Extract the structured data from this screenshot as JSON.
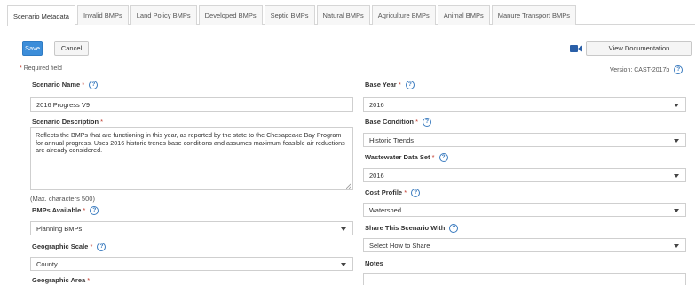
{
  "tabs": [
    {
      "label": "Scenario Metadata",
      "active": true
    },
    {
      "label": "Invalid BMPs"
    },
    {
      "label": "Land Policy BMPs"
    },
    {
      "label": "Developed BMPs"
    },
    {
      "label": "Septic BMPs"
    },
    {
      "label": "Natural BMPs"
    },
    {
      "label": "Agriculture BMPs"
    },
    {
      "label": "Animal BMPs"
    },
    {
      "label": "Manure Transport BMPs"
    }
  ],
  "toolbar": {
    "save_label": "Save",
    "cancel_label": "Cancel",
    "doc_label": "View Documentation"
  },
  "meta": {
    "required_star": "*",
    "required_text": "Required field",
    "version_text": "Version: CAST-2017b",
    "help_glyph": "?"
  },
  "form": {
    "scenario_name": {
      "label": "Scenario Name",
      "value": "2016 Progress V9"
    },
    "scenario_description": {
      "label": "Scenario Description",
      "value": "Reflects the BMPs that are functioning in this year, as reported by the state to the Chesapeake Bay Program for annual progress. Uses 2016 historic trends base conditions and assumes maximum feasible air reductions are already considered.",
      "max_chars": "(Max. characters 500)"
    },
    "bmps_available": {
      "label": "BMPs Available",
      "value": "Planning BMPs"
    },
    "geographic_scale": {
      "label": "Geographic Scale",
      "value": "County"
    },
    "geographic_area": {
      "label": "Geographic Area"
    },
    "base_year": {
      "label": "Base Year",
      "value": "2016"
    },
    "base_condition": {
      "label": "Base Condition",
      "value": "Historic Trends"
    },
    "wastewater_data_set": {
      "label": "Wastewater Data Set",
      "value": "2016"
    },
    "cost_profile": {
      "label": "Cost Profile",
      "value": "Watershed"
    },
    "share_with": {
      "label": "Share This Scenario With",
      "value": "Select How to Share"
    },
    "notes": {
      "label": "Notes"
    }
  },
  "colors": {
    "primary_button": "#3c8dd9",
    "required_star": "#c0392b",
    "help_icon": "#3a7bbf",
    "video_icon": "#2a5fa8"
  }
}
